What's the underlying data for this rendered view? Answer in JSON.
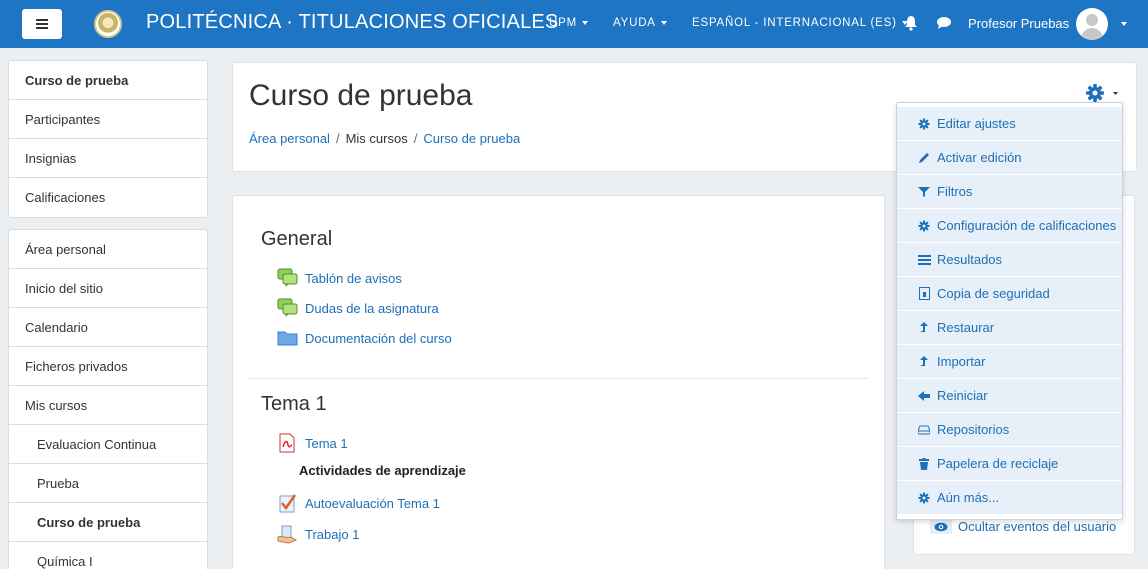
{
  "navbar": {
    "site_title": "POLITÉCNICA · TITULACIONES OFICIALES",
    "upm": "UPM",
    "ayuda": "AYUDA",
    "language": "ESPAÑOL - INTERNACIONAL (ES)",
    "user_name": "Profesor Pruebas",
    "brand_color": "#1d75c4"
  },
  "leftnav": {
    "course_group": [
      "Curso de prueba",
      "Participantes",
      "Insignias",
      "Calificaciones"
    ],
    "site_group": [
      "Área personal",
      "Inicio del sitio",
      "Calendario",
      "Ficheros privados",
      "Mis cursos"
    ],
    "courses": [
      "Evaluacion Continua",
      "Prueba",
      "Curso de prueba",
      "Química I"
    ]
  },
  "header": {
    "title": "Curso de prueba",
    "breadcrumb": [
      "Área personal",
      "Mis cursos",
      "Curso de prueba"
    ]
  },
  "sections": {
    "general": {
      "title": "General",
      "activities": [
        "Tablón de avisos",
        "Dudas de la asignatura",
        "Documentación del curso"
      ]
    },
    "tema1": {
      "title": "Tema 1",
      "resource": "Tema 1",
      "label": "Actividades de aprendizaje",
      "activities": [
        "Autoevaluación Tema 1",
        "Trabajo 1"
      ]
    }
  },
  "settings_menu": {
    "items": [
      {
        "label": "Editar ajustes",
        "icon": "gear-icon"
      },
      {
        "label": "Activar edición",
        "icon": "pencil-icon"
      },
      {
        "label": "Filtros",
        "icon": "filter-icon"
      },
      {
        "label": "Configuración de calificaciones",
        "icon": "gear-icon"
      },
      {
        "label": "Resultados",
        "icon": "list-icon"
      },
      {
        "label": "Copia de seguridad",
        "icon": "backup-icon"
      },
      {
        "label": "Restaurar",
        "icon": "upload-icon"
      },
      {
        "label": "Importar",
        "icon": "upload-icon"
      },
      {
        "label": "Reiniciar",
        "icon": "arrow-left-icon"
      },
      {
        "label": "Repositorios",
        "icon": "drive-icon"
      },
      {
        "label": "Papelera de reciclaje",
        "icon": "trash-icon"
      },
      {
        "label": "Aún más...",
        "icon": "gear-icon"
      }
    ]
  },
  "right_block": {
    "hide_events": "Ocultar eventos del usuario"
  }
}
